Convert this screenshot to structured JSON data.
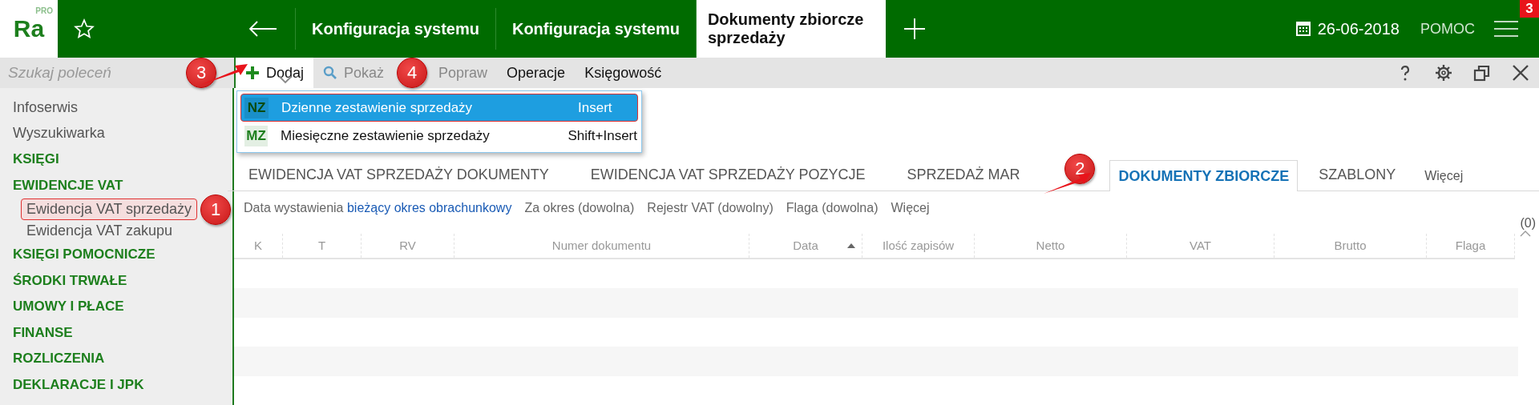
{
  "app": {
    "logo": "Ra",
    "logo_sup": "PRO"
  },
  "top_tabs": [
    {
      "label": "Konfiguracja systemu",
      "selected": false
    },
    {
      "label": "Konfiguracja systemu",
      "selected": false
    },
    {
      "label": "Dokumenty zbiorcze sprzedaży",
      "selected": true
    }
  ],
  "date": "26-06-2018",
  "help": "POMOC",
  "menu_badge": "3",
  "search": {
    "placeholder": "Szukaj poleceń"
  },
  "toolbar": [
    {
      "label": "Dodaj",
      "disabled": false,
      "open": true
    },
    {
      "label": "Pokaż",
      "disabled": true,
      "open": false
    },
    {
      "label": "Popraw",
      "disabled": true,
      "open": false
    },
    {
      "label": "Operacje",
      "disabled": false,
      "open": false
    },
    {
      "label": "Księgowość",
      "disabled": false,
      "open": false
    }
  ],
  "dropdown": [
    {
      "code": "NZ",
      "label": "Dzienne zestawienie sprzedaży",
      "shortcut": "Insert",
      "selected": true
    },
    {
      "code": "MZ",
      "label": "Miesięczne zestawienie sprzedaży",
      "shortcut": "Shift+Insert",
      "selected": false
    }
  ],
  "sidebar": {
    "items": [
      {
        "label": "Infoserwis",
        "kind": "link"
      },
      {
        "label": "Wyszukiwarka",
        "kind": "link"
      },
      {
        "label": "KSIĘGI",
        "kind": "section"
      },
      {
        "label": "EWIDENCJE VAT",
        "kind": "section",
        "children": [
          {
            "label": "Ewidencja VAT sprzedaży",
            "selected": true
          },
          {
            "label": "Ewidencja VAT zakupu",
            "selected": false
          }
        ]
      },
      {
        "label": "KSIĘGI POMOCNICZE",
        "kind": "section"
      },
      {
        "label": "ŚRODKI TRWAŁE",
        "kind": "section"
      },
      {
        "label": "UMOWY I PŁACE",
        "kind": "section"
      },
      {
        "label": "FINANSE",
        "kind": "section"
      },
      {
        "label": "ROZLICZENIA",
        "kind": "section"
      },
      {
        "label": "DEKLARACJE I JPK",
        "kind": "section"
      }
    ]
  },
  "tabs": [
    {
      "label": "EWIDENCJA VAT SPRZEDAŻY DOKUMENTY",
      "selected": false
    },
    {
      "label": "EWIDENCJA VAT SPRZEDAŻY POZYCJE",
      "selected": false
    },
    {
      "label": "SPRZEDAŻ MAR",
      "selected": false
    },
    {
      "label": "DOKUMENTY ZBIORCZE",
      "selected": true
    },
    {
      "label": "SZABLONY",
      "selected": false
    },
    {
      "label": "Więcej",
      "selected": false
    }
  ],
  "filters": [
    {
      "label": "Data wystawienia",
      "value": "bieżący okres obrachunkowy"
    },
    {
      "label": "Za okres (dowolna)"
    },
    {
      "label": "Rejestr VAT (dowolny)"
    },
    {
      "label": "Flaga (dowolna)"
    },
    {
      "label": "Więcej"
    }
  ],
  "count": "(0)",
  "table": {
    "columns": [
      {
        "label": "K"
      },
      {
        "label": "T"
      },
      {
        "label": "RV"
      },
      {
        "label": "Numer dokumentu"
      },
      {
        "label": "Data",
        "sorted": true
      },
      {
        "label": "Ilość zapisów"
      },
      {
        "label": "Netto"
      },
      {
        "label": "VAT"
      },
      {
        "label": "Brutto"
      },
      {
        "label": "Flaga"
      }
    ]
  },
  "callouts": [
    {
      "number": "1"
    },
    {
      "number": "2"
    },
    {
      "number": "3"
    },
    {
      "number": "4"
    }
  ]
}
